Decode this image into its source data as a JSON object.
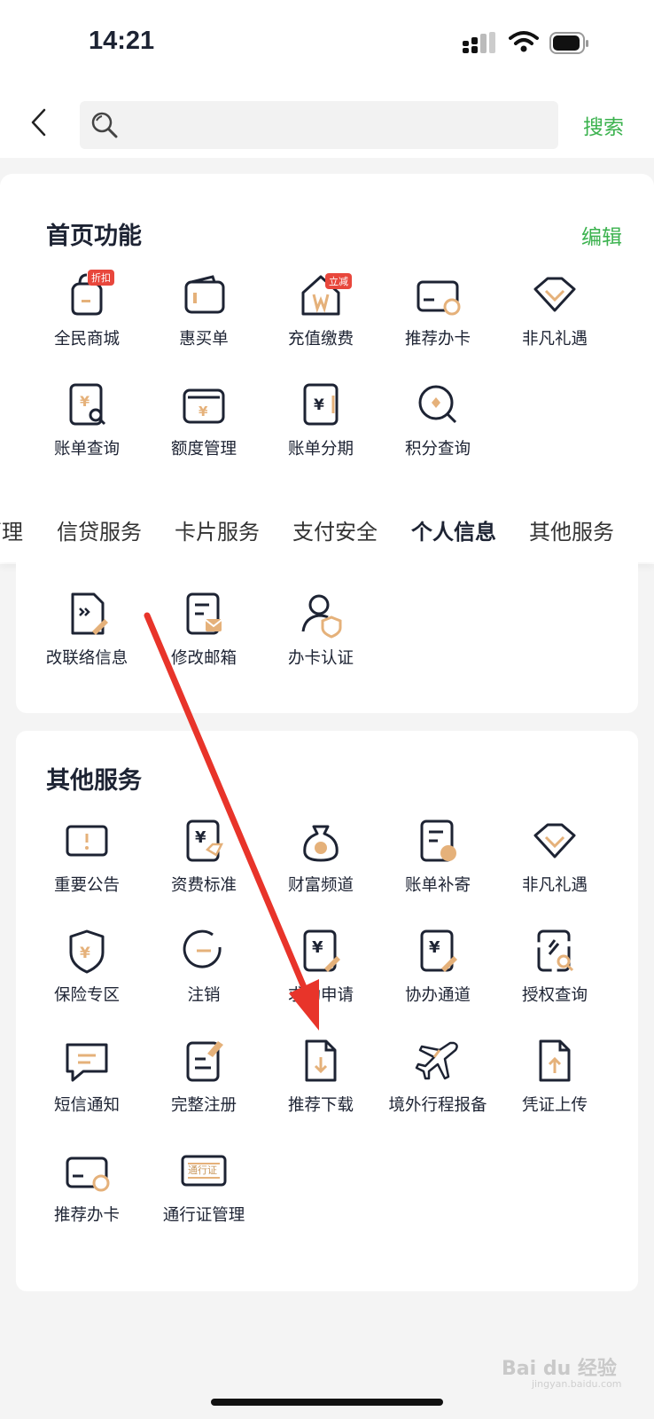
{
  "status_bar": {
    "time": "14:21"
  },
  "search": {
    "placeholder": "",
    "button": "搜索"
  },
  "home_functions": {
    "title": "首页功能",
    "edit": "编辑",
    "items": [
      {
        "label": "全民商城",
        "icon": "shopping-bag-icon",
        "badge": "折扣"
      },
      {
        "label": "惠买单",
        "icon": "wallet-icon"
      },
      {
        "label": "充值缴费",
        "icon": "home-recharge-icon",
        "badge": "立减"
      },
      {
        "label": "推荐办卡",
        "icon": "card-recommend-icon"
      },
      {
        "label": "非凡礼遇",
        "icon": "diamond-icon"
      },
      {
        "label": "账单查询",
        "icon": "bill-search-icon"
      },
      {
        "label": "额度管理",
        "icon": "wallet-yen-icon"
      },
      {
        "label": "账单分期",
        "icon": "bill-installment-icon"
      },
      {
        "label": "积分查询",
        "icon": "points-search-icon"
      }
    ]
  },
  "tabs": [
    {
      "label": "管理",
      "active": false
    },
    {
      "label": "信贷服务",
      "active": false
    },
    {
      "label": "卡片服务",
      "active": false
    },
    {
      "label": "支付安全",
      "active": false
    },
    {
      "label": "个人信息",
      "active": true
    },
    {
      "label": "其他服务",
      "active": false
    }
  ],
  "personal_info": {
    "items": [
      {
        "label": "改联络信息",
        "icon": "edit-contact-icon"
      },
      {
        "label": "修改邮箱",
        "icon": "edit-email-icon"
      },
      {
        "label": "办卡认证",
        "icon": "user-verify-icon"
      }
    ]
  },
  "other_services": {
    "title": "其他服务",
    "items": [
      {
        "label": "重要公告",
        "icon": "announcement-icon"
      },
      {
        "label": "资费标准",
        "icon": "fee-standard-icon"
      },
      {
        "label": "财富频道",
        "icon": "money-bag-icon"
      },
      {
        "label": "账单补寄",
        "icon": "bill-resend-icon"
      },
      {
        "label": "非凡礼遇",
        "icon": "diamond-icon"
      },
      {
        "label": "保险专区",
        "icon": "insurance-shield-icon"
      },
      {
        "label": "注销",
        "icon": "cancel-icon"
      },
      {
        "label": "求助申请",
        "icon": "help-apply-icon"
      },
      {
        "label": "协办通道",
        "icon": "assist-channel-icon"
      },
      {
        "label": "授权查询",
        "icon": "authorization-search-icon"
      },
      {
        "label": "短信通知",
        "icon": "sms-icon"
      },
      {
        "label": "完整注册",
        "icon": "register-icon"
      },
      {
        "label": "推荐下载",
        "icon": "download-file-icon"
      },
      {
        "label": "境外行程报备",
        "icon": "airplane-icon"
      },
      {
        "label": "凭证上传",
        "icon": "upload-file-icon"
      },
      {
        "label": "推荐办卡",
        "icon": "card-recommend-icon"
      },
      {
        "label": "通行证管理",
        "icon": "pass-card-icon"
      }
    ],
    "pass_card_text": "通行证"
  },
  "watermark": {
    "text": "Bai du 经验",
    "sub": "jingyan.baidu.com"
  },
  "colors": {
    "accent": "#3bb24e",
    "icon_dark": "#1d2333",
    "icon_gold": "#e5b17a",
    "arrow": "#e8342a",
    "badge": "#e8473c"
  }
}
